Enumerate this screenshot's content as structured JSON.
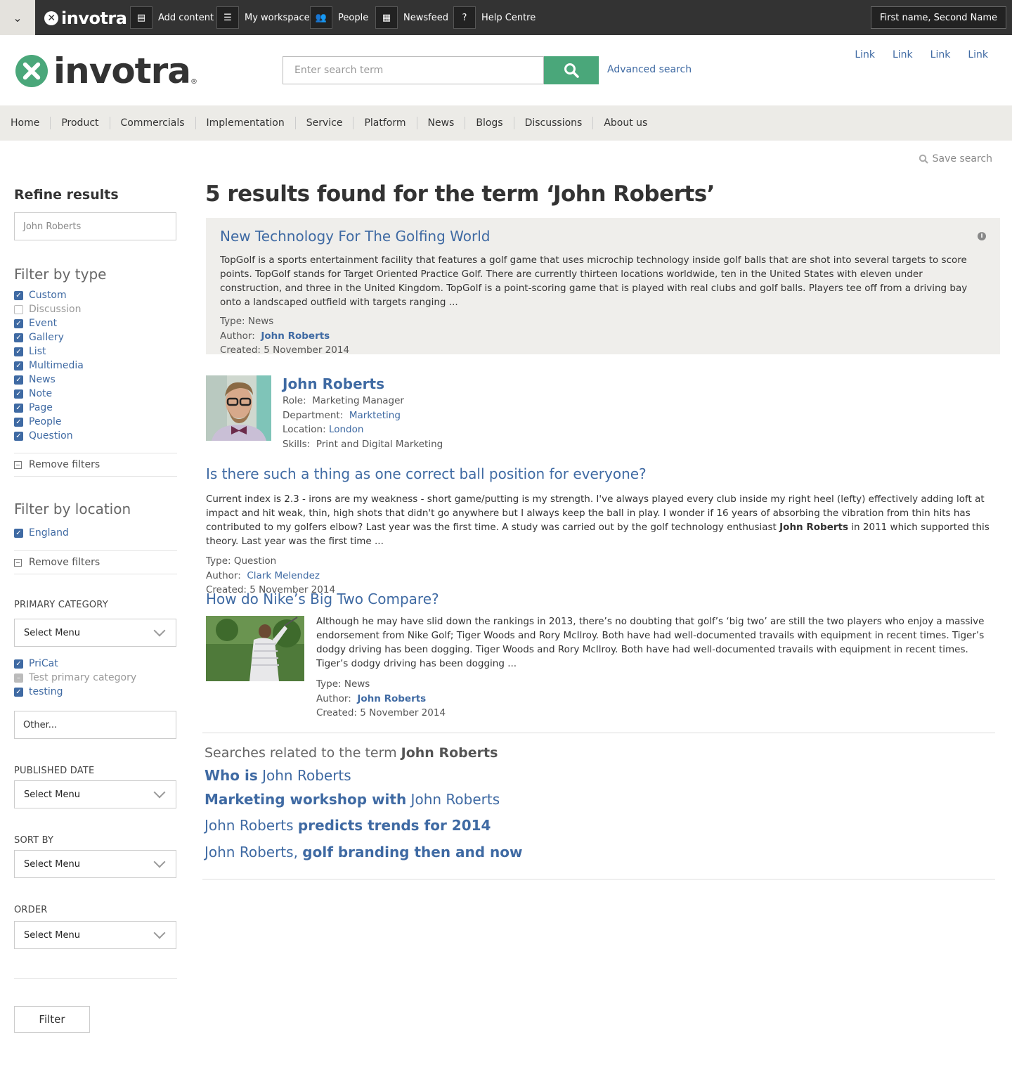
{
  "topbar": {
    "brand": "invotra",
    "items": [
      {
        "label": "Add content",
        "icon": "document-icon"
      },
      {
        "label": "My workspace",
        "icon": "list-icon"
      },
      {
        "label": "People",
        "icon": "people-icon"
      },
      {
        "label": "Newsfeed",
        "icon": "newspaper-icon"
      },
      {
        "label": "Help Centre",
        "icon": "question-icon"
      }
    ],
    "user": "First name, Second Name"
  },
  "header": {
    "brand": "invotra",
    "search_placeholder": "Enter search term",
    "advanced_search": "Advanced search",
    "links": [
      "Link",
      "Link",
      "Link",
      "Link"
    ]
  },
  "nav": [
    "Home",
    "Product",
    "Commercials",
    "Implementation",
    "Service",
    "Platform",
    "News",
    "Blogs",
    "Discussions",
    "About us"
  ],
  "save_search": "Save search",
  "sidebar": {
    "refine_title": "Refine results",
    "refine_value": "John Roberts",
    "filter_type_title": "Filter by type",
    "types": [
      {
        "label": "Custom",
        "state": "checked"
      },
      {
        "label": "Discussion",
        "state": "unchecked"
      },
      {
        "label": "Event",
        "state": "checked"
      },
      {
        "label": "Gallery",
        "state": "checked"
      },
      {
        "label": "List",
        "state": "checked"
      },
      {
        "label": "Multimedia",
        "state": "checked"
      },
      {
        "label": "News",
        "state": "checked"
      },
      {
        "label": "Note",
        "state": "checked"
      },
      {
        "label": "Page",
        "state": "checked"
      },
      {
        "label": "People",
        "state": "checked"
      },
      {
        "label": "Question",
        "state": "checked"
      }
    ],
    "remove_filters": "Remove filters",
    "filter_location_title": "Filter by location",
    "locations": [
      {
        "label": "England",
        "state": "checked"
      }
    ],
    "primary_category": "PRIMARY CATEGORY",
    "select_menu": "Select Menu",
    "categories": [
      {
        "label": "PriCat",
        "state": "checked"
      },
      {
        "label": "Test primary category",
        "state": "partial"
      },
      {
        "label": "testing",
        "state": "checked"
      }
    ],
    "other_placeholder": "Other...",
    "published_date": "PUBLISHED DATE",
    "sort_by": "SORT BY",
    "order": "ORDER",
    "filter_button": "Filter"
  },
  "results": {
    "title": "5 results found for the term ‘John Roberts’",
    "type_label": "Type:",
    "author_label": "Author:",
    "created_label": "Created:",
    "items": [
      {
        "title": "New Technology For The Golfing World",
        "body": "TopGolf is a sports entertainment facility that features a golf game that uses microchip technology inside golf balls that are shot into several targets to score points. TopGolf stands for Target Oriented Practice Golf. There are currently thirteen locations worldwide, ten in the United States with eleven under construction, and three in the United Kingdom. TopGolf is a point-scoring game that is played with real clubs and golf balls. Players tee off from a driving bay onto a landscaped outfield with targets ranging ...",
        "type": "News",
        "author": "John Roberts",
        "created": "5 November 2014"
      },
      {
        "title": "Is there such a thing as one correct ball position for everyone?",
        "body_pre": "Current index is 2.3 - irons are my weakness - short game/putting is my strength. I've always played every club inside my right heel (lefty) effectively adding loft at impact and hit weak, thin, high shots that didn't go anywhere but I always keep the ball in play.  I wonder if 16 years of absorbing the vibration from thin hits has contributed to my golfers elbow? Last year was the first time.  A study was carried out by the golf technology enthusiast ",
        "body_bold": "John Roberts",
        "body_post": " in 2011 which supported this theory.  Last year was the first time ...",
        "type": "Question",
        "author": "Clark Melendez",
        "created": "5 November 2014"
      },
      {
        "title": "How do Nike’s Big Two Compare?",
        "body": "Although he may have slid down the rankings in 2013, there’s no doubting that golf’s ‘big two’  are still the two players who enjoy a massive endorsement from Nike Golf; Tiger Woods and Rory McIlroy. Both have had well-documented travails with equipment in recent times. Tiger’s dodgy driving has been dogging. Tiger Woods and Rory McIlroy. Both have had well-documented travails with equipment in recent times. Tiger’s dodgy driving has been dogging ...",
        "type": "News",
        "author": "John Roberts",
        "created": "5 November 2014"
      }
    ],
    "person": {
      "name": "John Roberts",
      "role_label": "Role:",
      "role": "Marketing Manager",
      "department_label": "Department:",
      "department": "Markteting",
      "location_label": "Location:",
      "location": "London",
      "skills_label": "Skills:",
      "skills": "Print and Digital Marketing"
    }
  },
  "related": {
    "heading_pre": "Searches related to the term ",
    "heading_term": "John Roberts",
    "links": [
      {
        "bold": "Who is",
        "normal": " John Roberts",
        "order": "bold-first"
      },
      {
        "bold": "Marketing workshop with",
        "normal": " John Roberts",
        "order": "bold-first"
      },
      {
        "normal": "John Roberts ",
        "bold": "predicts trends for 2014",
        "order": "normal-first"
      },
      {
        "normal": "John Roberts, ",
        "bold": "golf branding then and now",
        "order": "normal-first"
      }
    ]
  },
  "colors": {
    "accent_green": "#4aa77a",
    "link_blue": "#3f6aa3",
    "topbar": "#333333",
    "nav_bg": "#ecebe7",
    "card_bg": "#efeeeb"
  }
}
